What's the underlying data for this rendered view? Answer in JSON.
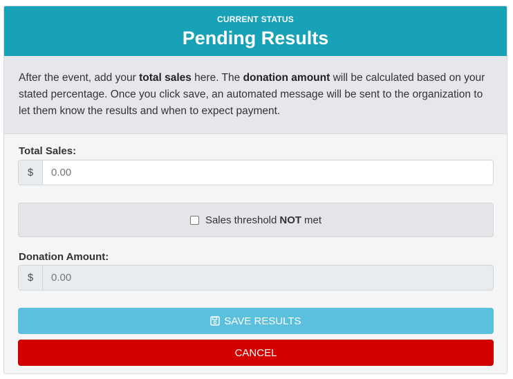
{
  "header": {
    "subtitle": "CURRENT STATUS",
    "title": "Pending Results"
  },
  "intro": {
    "part1": "After the event, add your ",
    "bold1": "total sales",
    "part2": " here. The ",
    "bold2": "donation amount",
    "part3": " will be calculated based on your stated percentage. Once you click save, an automated message will be sent to the organization to let them know the results and when to expect payment."
  },
  "total_sales": {
    "label": "Total Sales:",
    "currency": "$",
    "placeholder": "0.00"
  },
  "threshold": {
    "text_before": "Sales threshold",
    "text_bold": "NOT",
    "text_after": "met",
    "checked": false
  },
  "donation": {
    "label": "Donation Amount:",
    "currency": "$",
    "placeholder": "0.00"
  },
  "buttons": {
    "save_label": "SAVE RESULTS",
    "save_icon": "floppy-disk-icon",
    "cancel_label": "CANCEL"
  },
  "colors": {
    "header": "#17a2b8",
    "save": "#5bc0de",
    "cancel": "#d40000"
  }
}
